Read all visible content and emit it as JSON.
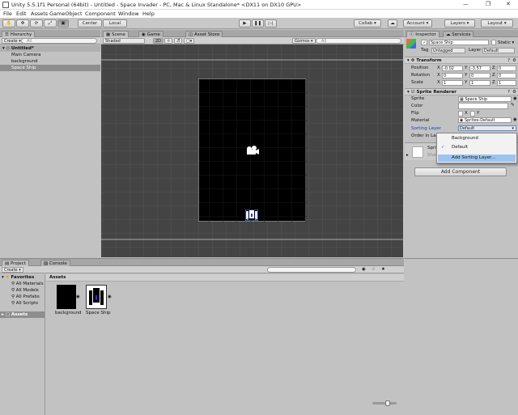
{
  "window": {
    "title": "Unity 5.5.1f1 Personal (64bit) - Untitled - Space Invader - PC, Mac & Linux Standalone* <DX11 on DX10 GPU>"
  },
  "menu": [
    "File",
    "Edit",
    "Assets",
    "GameObject",
    "Component",
    "Window",
    "Help"
  ],
  "toolbar": {
    "center": "Center",
    "local": "Local",
    "collab": "Collab ▾",
    "account": "Account ▾",
    "layers": "Layers ▾",
    "layout": "Layout ▾"
  },
  "hierarchy": {
    "tab": "Hierarchy",
    "create": "Create ▾",
    "search": "All",
    "scene": "Untitled*",
    "items": [
      "Main Camera",
      "background",
      "Space Ship"
    ]
  },
  "scene_view": {
    "tabs": [
      "Scene",
      "Game",
      "Asset Store"
    ],
    "shading": "Shaded",
    "mode2d": "2D",
    "gizmos": "Gizmos ▾",
    "search": "All"
  },
  "inspector": {
    "tabs": [
      "Inspector",
      "Services"
    ],
    "object_name": "Space Ship",
    "static": "Static ▾",
    "tag_label": "Tag",
    "tag_value": "Untagged",
    "layer_label": "Layer",
    "layer_value": "Default",
    "transform": {
      "title": "Transform",
      "position_label": "Position",
      "rotation_label": "Rotation",
      "scale_label": "Scale",
      "position": [
        "-0.02",
        "-3.57",
        "0"
      ],
      "rotation": [
        "0",
        "0",
        "0"
      ],
      "scale": [
        "1",
        "1",
        "1"
      ]
    },
    "sprite_renderer": {
      "title": "Sprite Renderer",
      "sprite_label": "Sprite",
      "sprite_value": "Space Ship",
      "color_label": "Color",
      "flip_label": "Flip",
      "material_label": "Material",
      "material_value": "Sprites-Default",
      "sorting_label": "Sorting Layer",
      "sorting_value": "Default",
      "order_label": "Order in La"
    },
    "preview_label": "Spri",
    "shader_label": "Shad",
    "add_component": "Add Component"
  },
  "sorting_dropdown": {
    "items": [
      "Background",
      "Default",
      "Add Sorting Layer..."
    ],
    "checked": "Default",
    "highlighted": "Add Sorting Layer..."
  },
  "project": {
    "tabs": [
      "Project",
      "Console"
    ],
    "create": "Create ▾",
    "favorites": "Favorites",
    "fav_items": [
      "All Materials",
      "All Models",
      "All Prefabs",
      "All Scripts"
    ],
    "assets_root": "Assets",
    "breadcrumb": "Assets",
    "assets": [
      "background",
      "Space Ship"
    ]
  }
}
